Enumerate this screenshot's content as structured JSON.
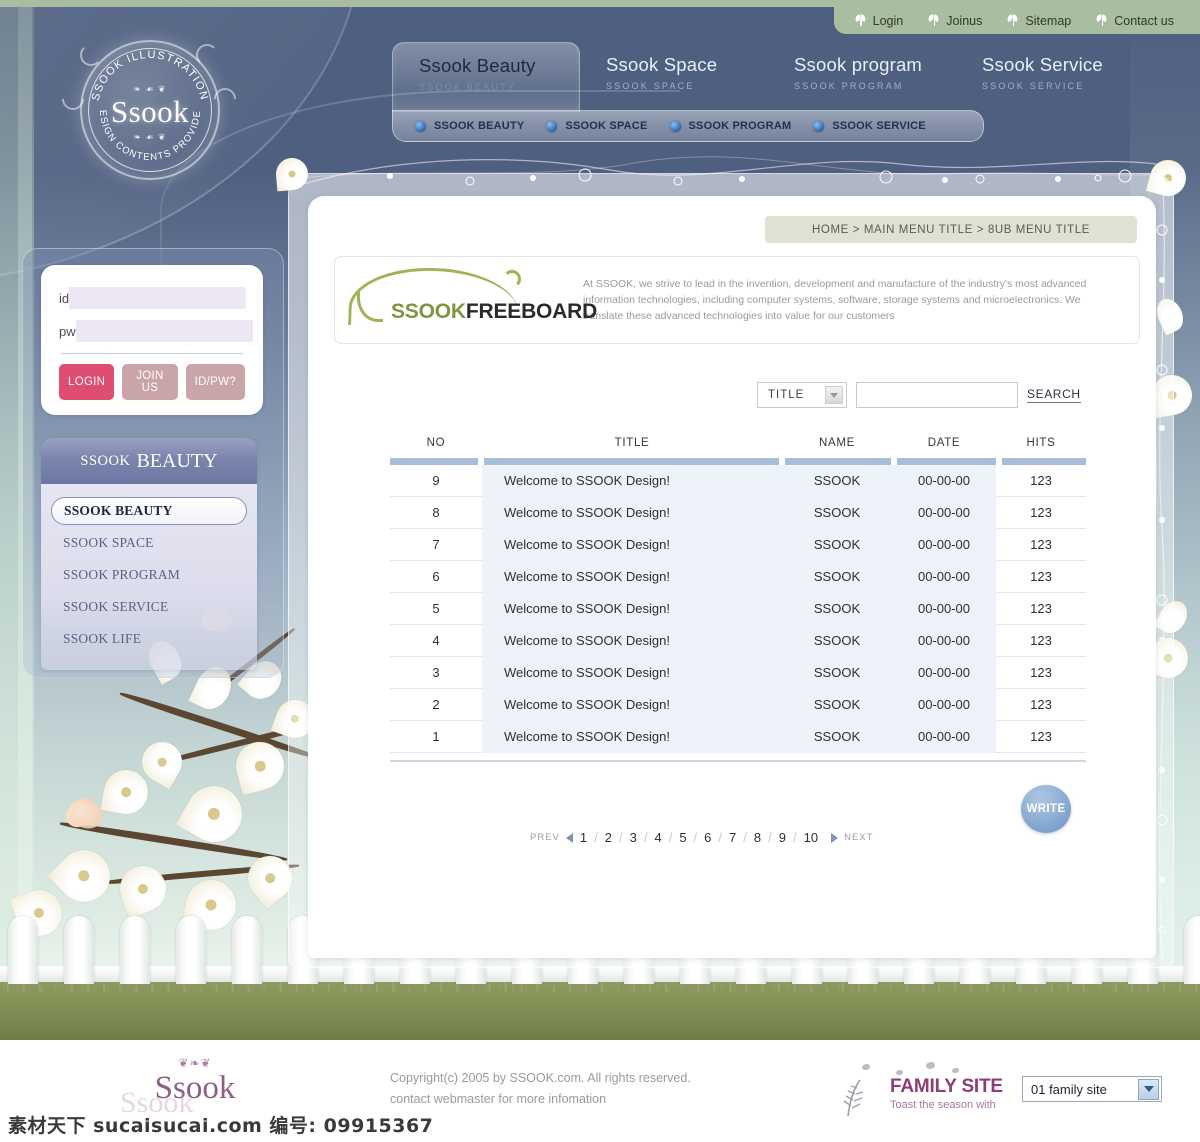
{
  "topnav": {
    "items": [
      {
        "label": "Login",
        "icon": "sprout-icon"
      },
      {
        "label": "Joinus",
        "icon": "sprout-icon"
      },
      {
        "label": "Sitemap",
        "icon": "sprout-icon"
      },
      {
        "label": "Contact us",
        "icon": "sprout-icon"
      }
    ]
  },
  "logo": {
    "center": "Ssook",
    "ring_top": "SSOOK ILLUSTRATION",
    "ring_bottom": "DESIGN CONTENTS PROVIDER",
    "ornament": "❧ ☙ ❦"
  },
  "tabs": [
    {
      "title": "Ssook Beauty",
      "sub": "SSOOK BEAUTY",
      "active": true
    },
    {
      "title": "Ssook Space",
      "sub": "SSOOK SPACE",
      "active": false
    },
    {
      "title": "Ssook program",
      "sub": "SSOOK PROGRAM",
      "active": false
    },
    {
      "title": "Ssook Service",
      "sub": "SSOOK SERVICE",
      "active": false
    }
  ],
  "subnav": [
    {
      "label": "SSOOK BEAUTY"
    },
    {
      "label": "SSOOK SPACE"
    },
    {
      "label": "SSOOK PROGRAM"
    },
    {
      "label": "SSOOK SERVICE"
    }
  ],
  "login": {
    "id_label": "id",
    "pw_label": "pw",
    "id_value": "",
    "pw_value": "",
    "id_placeholder": "",
    "pw_placeholder": "",
    "login_label": "LOGIN",
    "join_label": "JOIN US",
    "idpw_label": "ID/PW?"
  },
  "sidemenu": {
    "head_light": "SSOOK",
    "head_bold": "BEAUTY",
    "items": [
      {
        "label": "SSOOK BEAUTY",
        "active": true
      },
      {
        "label": "SSOOK SPACE",
        "active": false
      },
      {
        "label": "SSOOK PROGRAM",
        "active": false
      },
      {
        "label": "SSOOK SERVICE",
        "active": false
      },
      {
        "label": "SSOOK LIFE",
        "active": false
      }
    ]
  },
  "breadcrumb": "HOME > MAIN MENU TITLE > 8UB MENU TITLE",
  "board_header": {
    "title_green": "SSOOK",
    "title_dark": "FREEBOARD",
    "description": "At SSOOK, we strive to lead in the invention, development and manufacture of the industry's most advanced information technologies, including computer systems, software, storage systems and microelectronics. We translate these advanced technologies into value for our customers"
  },
  "search": {
    "select_value": "TITLE",
    "input_value": "",
    "input_placeholder": "",
    "button_label": "SEARCH"
  },
  "table": {
    "columns": [
      "NO",
      "TITLE",
      "NAME",
      "DATE",
      "HITS"
    ],
    "rows": [
      {
        "no": "9",
        "title": "Welcome to SSOOK Design!",
        "name": "SSOOK",
        "date": "00-00-00",
        "hits": "123"
      },
      {
        "no": "8",
        "title": "Welcome to SSOOK Design!",
        "name": "SSOOK",
        "date": "00-00-00",
        "hits": "123"
      },
      {
        "no": "7",
        "title": "Welcome to SSOOK Design!",
        "name": "SSOOK",
        "date": "00-00-00",
        "hits": "123"
      },
      {
        "no": "6",
        "title": "Welcome to SSOOK Design!",
        "name": "SSOOK",
        "date": "00-00-00",
        "hits": "123"
      },
      {
        "no": "5",
        "title": "Welcome to SSOOK Design!",
        "name": "SSOOK",
        "date": "00-00-00",
        "hits": "123"
      },
      {
        "no": "4",
        "title": "Welcome to SSOOK Design!",
        "name": "SSOOK",
        "date": "00-00-00",
        "hits": "123"
      },
      {
        "no": "3",
        "title": "Welcome to SSOOK Design!",
        "name": "SSOOK",
        "date": "00-00-00",
        "hits": "123"
      },
      {
        "no": "2",
        "title": "Welcome to SSOOK Design!",
        "name": "SSOOK",
        "date": "00-00-00",
        "hits": "123"
      },
      {
        "no": "1",
        "title": "Welcome to SSOOK Design!",
        "name": "SSOOK",
        "date": "00-00-00",
        "hits": "123"
      }
    ]
  },
  "write_label": "WRITE",
  "pagination": {
    "prev_label": "PREV",
    "next_label": "NEXT",
    "pages": [
      "1",
      "2",
      "3",
      "4",
      "5",
      "6",
      "7",
      "8",
      "9",
      "10"
    ],
    "current": "1"
  },
  "footer": {
    "logo_name": "Ssook",
    "logo_ornament": "❦❧❦",
    "copyright_line1": "Copyright(c) 2005 by SSOOK.com. All rights reserved.",
    "copyright_line2": "contact webmaster for more infomation",
    "family_title": "FAMILY SITE",
    "family_sub": "Toast the season with",
    "family_select_value": "01 family site"
  },
  "watermark": "素材天下 sucaisucai.com  编号: 09915367",
  "colors": {
    "header_blue": "#4e5f80",
    "sage": "#a9bda0",
    "accent_blue": "#a8bdd8",
    "login_primary": "#e04d72",
    "login_secondary": "#c9a4a8",
    "green_title": "#7f9540",
    "footer_purple": "#8d5f85",
    "row_tint": "#eef2f9"
  }
}
